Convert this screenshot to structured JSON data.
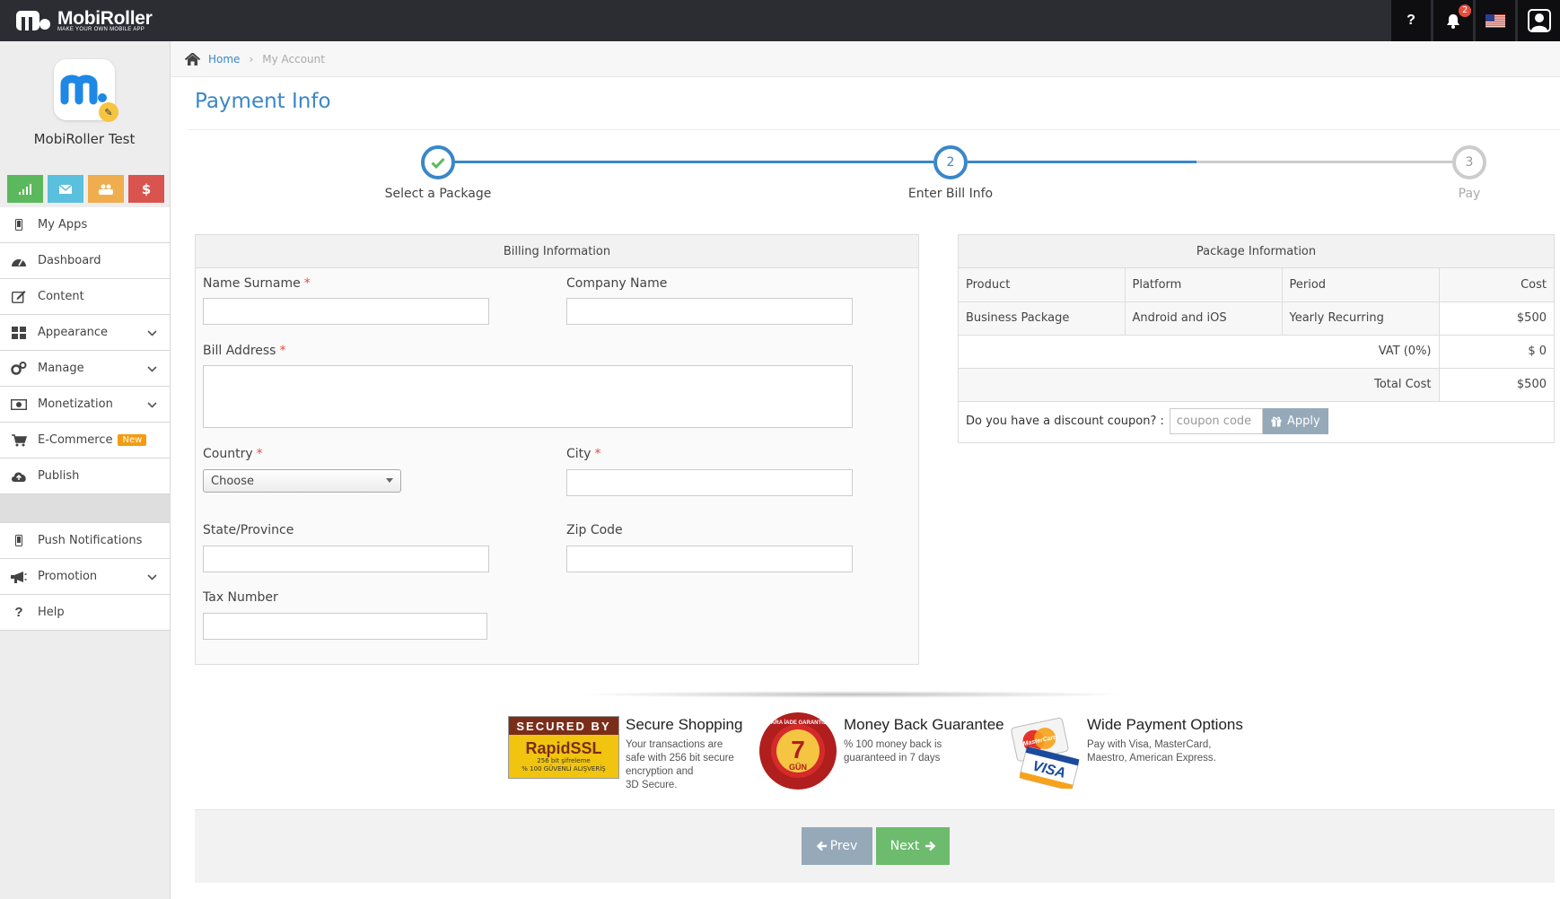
{
  "topbar": {
    "logo_title": "MobiRoller",
    "logo_tagline": "MAKE YOUR OWN MOBILE APP",
    "help_label": "?",
    "notification_count": "2"
  },
  "sidebar": {
    "app_name": "MobiRoller Test",
    "quick_buttons": [
      {
        "icon": "signal-icon",
        "color": "#5cb85c"
      },
      {
        "icon": "envelope-icon",
        "color": "#5bc0de"
      },
      {
        "icon": "users-icon",
        "color": "#f0ad4e"
      },
      {
        "icon": "dollar-icon",
        "label": "$",
        "color": "#d9534f"
      }
    ],
    "items": [
      {
        "label": "My Apps"
      },
      {
        "label": "Dashboard"
      },
      {
        "label": "Content"
      },
      {
        "label": "Appearance"
      },
      {
        "label": "Manage"
      },
      {
        "label": "Monetization"
      },
      {
        "label": "E-Commerce",
        "badge": "New"
      },
      {
        "label": "Publish"
      },
      {
        "label": "Push Notifications"
      },
      {
        "label": "Promotion"
      },
      {
        "label": "Help"
      }
    ]
  },
  "breadcrumb": {
    "home": "Home",
    "current": "My Account"
  },
  "page": {
    "title": "Payment Info"
  },
  "steps": [
    {
      "number": "",
      "label": "Select a Package",
      "state": "done"
    },
    {
      "number": "2",
      "label": "Enter Bill Info",
      "state": "active"
    },
    {
      "number": "3",
      "label": "Pay",
      "state": "todo"
    }
  ],
  "billing": {
    "title": "Billing Information",
    "name_label": "Name Surname",
    "company_label": "Company Name",
    "address_label": "Bill Address",
    "country_label": "Country",
    "country_value": "Choose",
    "city_label": "City",
    "state_label": "State/Province",
    "zip_label": "Zip Code",
    "tax_label": "Tax Number",
    "required_mark": "*"
  },
  "package": {
    "title": "Package Information",
    "headers": {
      "product": "Product",
      "platform": "Platform",
      "period": "Period",
      "cost": "Cost"
    },
    "row": {
      "product": "Business Package",
      "platform": "Android and iOS",
      "period": "Yearly Recurring",
      "cost": "$500"
    },
    "vat_label": "VAT (0%)",
    "vat_value": "$ 0",
    "total_label": "Total Cost",
    "total_value": "$500",
    "coupon_prompt": "Do you have a discount coupon? :",
    "coupon_placeholder": "coupon code",
    "apply_label": "Apply"
  },
  "trust": {
    "ssl_badge": {
      "line1": "SECURED BY",
      "line2": "RapidSSL",
      "line3": "256 bit şifreleme",
      "line4": "% 100 GÜVENLİ ALIŞVERİŞ"
    },
    "secure_title": "Secure Shopping",
    "secure_text": [
      "Your transactions are",
      "safe with 256 bit secure",
      "encryption and",
      "3D Secure."
    ],
    "money_badge": {
      "ring": "PARA İADE GARANTİSİ",
      "number": "7",
      "unit": "GÜN"
    },
    "money_title": "Money Back Guarantee",
    "money_text": [
      "% 100 money back is",
      "guaranteed in 7 days"
    ],
    "cards_badge": {
      "mastercard": "MasterCard",
      "visa": "VISA"
    },
    "payment_title": "Wide Payment Options",
    "payment_text": [
      "Pay with Visa, MasterCard,",
      "Maestro, American Express."
    ]
  },
  "footer": {
    "prev_label": "Prev",
    "next_label": "Next"
  },
  "colors": {
    "accent": "#3a87c8",
    "topbar": "#2b2d33",
    "next": "#6dbb6d",
    "prev": "#95a9b9",
    "required": "#e74c3c"
  }
}
